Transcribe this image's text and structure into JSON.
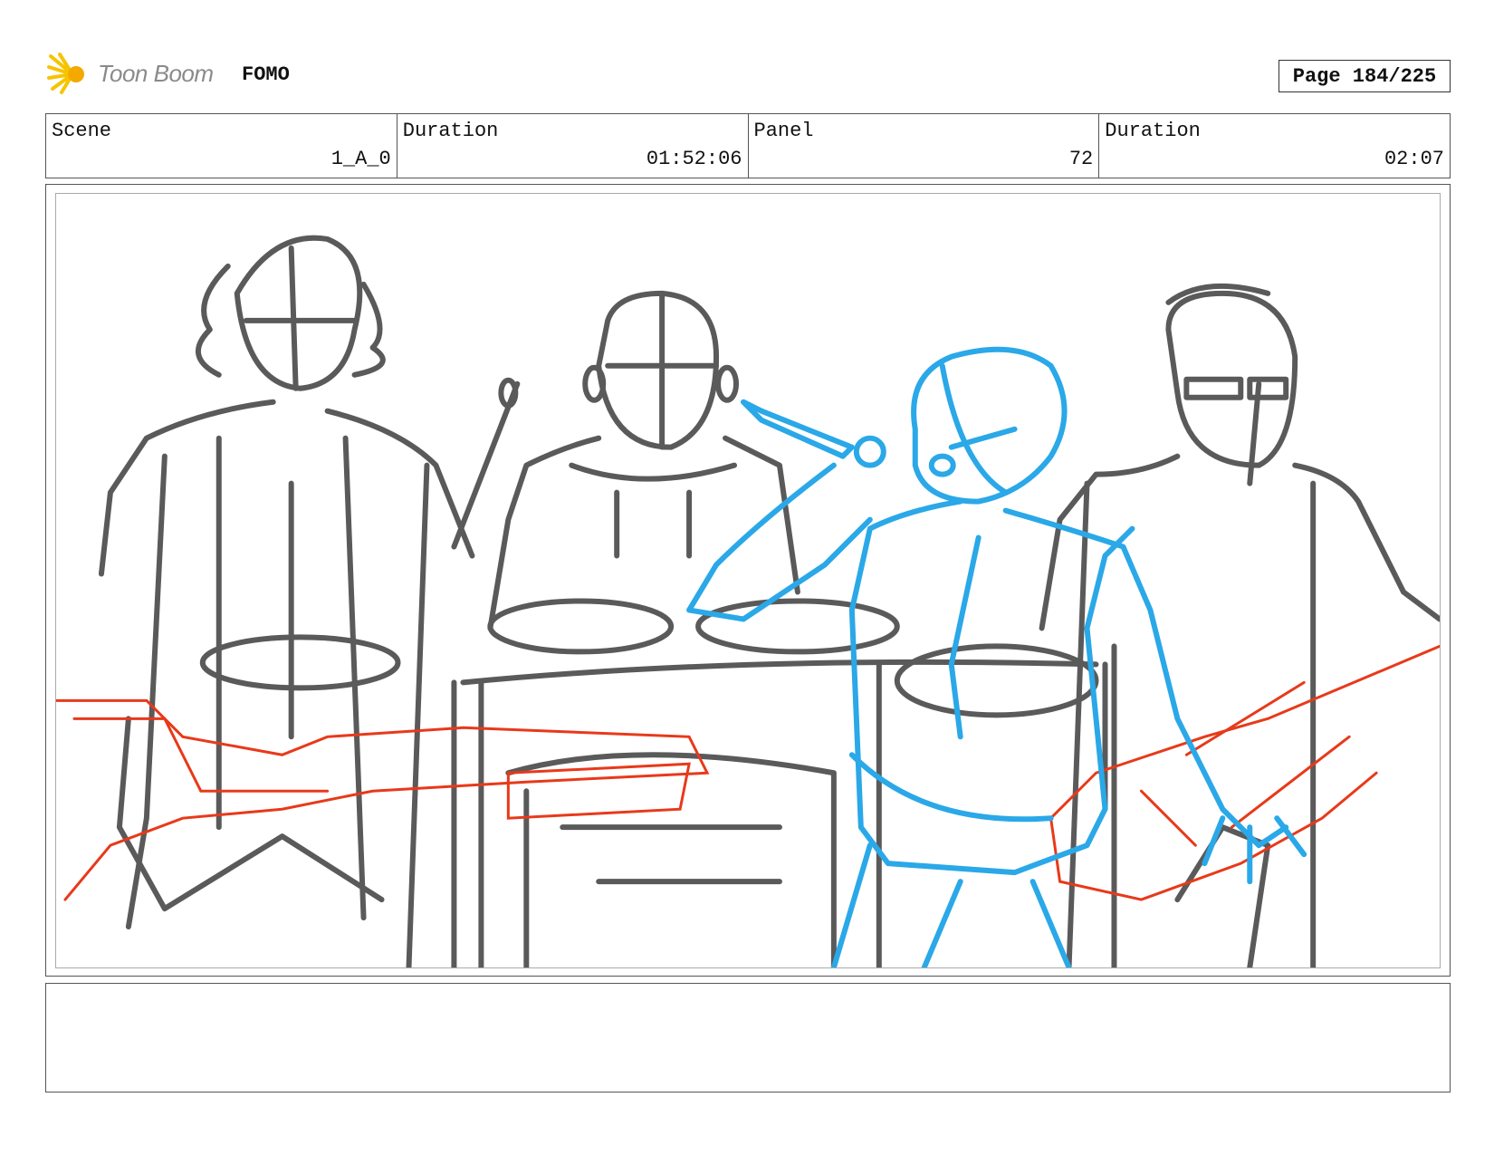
{
  "header": {
    "logo_text": "Toon Boom",
    "project_title": "FOMO",
    "page_label": "Page 184/225"
  },
  "info": {
    "scene_label": "Scene",
    "scene_value": "1_A_0",
    "scene_duration_label": "Duration",
    "scene_duration_value": "01:52:06",
    "panel_label": "Panel",
    "panel_value": "72",
    "panel_duration_label": "Duration",
    "panel_duration_value": "02:07"
  },
  "panel_image": {
    "description_icon": "storyboard-sketch",
    "colors": {
      "sketch": "#5a5a5a",
      "singer": "#2aa8e8",
      "guitars": "#e8391a"
    }
  },
  "notes": {
    "text": ""
  }
}
